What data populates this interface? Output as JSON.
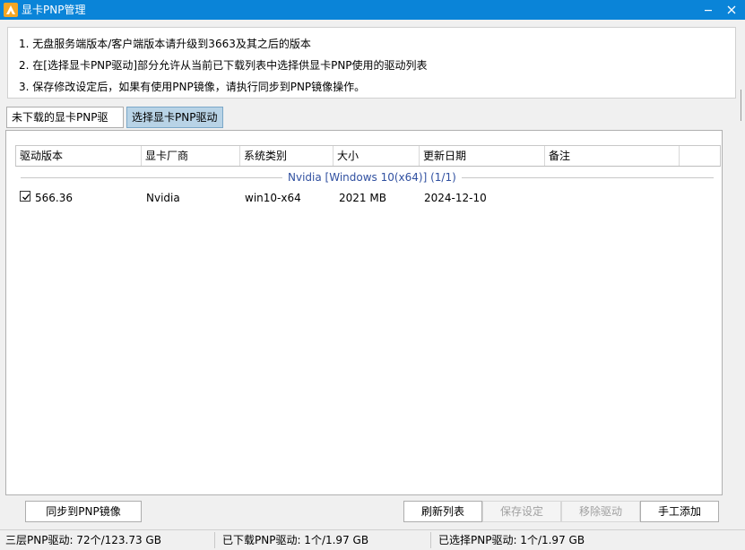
{
  "window": {
    "title": "显卡PNP管理"
  },
  "info": {
    "line1": "1. 无盘服务端版本/客户端版本请升级到3663及其之后的版本",
    "line2": "2. 在[选择显卡PNP驱动]部分允许从当前已下载列表中选择供显卡PNP使用的驱动列表",
    "line3": "3. 保存修改设定后，如果有使用PNP镜像，请执行同步到PNP镜像操作。"
  },
  "tabs": [
    {
      "label": "未下载的显卡PNP驱动"
    },
    {
      "label": "选择显卡PNP驱动"
    }
  ],
  "table": {
    "columns": [
      "驱动版本",
      "显卡厂商",
      "系统类别",
      "大小",
      "更新日期",
      "备注"
    ],
    "group_label": "Nvidia [Windows 10(x64)] (1/1)",
    "rows": [
      {
        "checked": true,
        "version": "566.36",
        "vendor": "Nvidia",
        "os": "win10-x64",
        "size": "2021 MB",
        "date": "2024-12-10",
        "note": ""
      }
    ]
  },
  "buttons": {
    "sync": "同步到PNP镜像",
    "refresh": "刷新列表",
    "save": "保存设定",
    "remove": "移除驱动",
    "add": "手工添加"
  },
  "status": {
    "total": "三层PNP驱动: 72个/123.73 GB",
    "downloaded": "已下载PNP驱动: 1个/1.97 GB",
    "selected": "已选择PNP驱动: 1个/1.97 GB"
  },
  "colors": {
    "titlebar": "#0a84d8",
    "accent": "#3050a0"
  }
}
